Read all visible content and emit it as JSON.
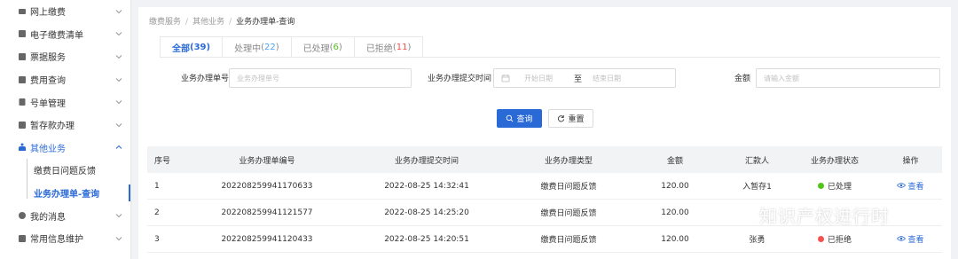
{
  "sidebar": {
    "items": [
      {
        "label": "网上缴费"
      },
      {
        "label": "电子缴费清单"
      },
      {
        "label": "票据服务"
      },
      {
        "label": "费用查询"
      },
      {
        "label": "号单管理"
      },
      {
        "label": "暂存款办理"
      },
      {
        "label": "其他业务"
      },
      {
        "label": "我的消息"
      },
      {
        "label": "常用信息维护"
      }
    ],
    "subitems": [
      {
        "label": "缴费日问题反馈"
      },
      {
        "label": "业务办理单-查询"
      }
    ]
  },
  "breadcrumb": {
    "item1": "缴费服务",
    "item2": "其他业务",
    "current": "业务办理单-查询",
    "sep": "/"
  },
  "tabs": [
    {
      "label": "全部",
      "count": "39",
      "open": "(",
      "close": ")"
    },
    {
      "label": "处理中",
      "count": "22",
      "open": "(",
      "close": ")"
    },
    {
      "label": "已处理",
      "count": "6",
      "open": "(",
      "close": ")"
    },
    {
      "label": "已拒绝",
      "count": "11",
      "open": "(",
      "close": ")"
    }
  ],
  "filters": {
    "order_label": "业务办理单号",
    "order_placeholder": "业务办理单号",
    "time_label": "业务办理提交时间",
    "start_placeholder": "开始日期",
    "to": "至",
    "end_placeholder": "结束日期",
    "amount_label": "金额",
    "amount_placeholder": "请输入金额"
  },
  "buttons": {
    "search": "查询",
    "reset": "重置"
  },
  "table": {
    "headers": [
      "序号",
      "业务办理单编号",
      "业务办理提交时间",
      "业务办理类型",
      "金额",
      "汇款人",
      "业务办理状态",
      "操作"
    ],
    "rows": [
      {
        "idx": "1",
        "no": "202208259941170633",
        "time": "2022-08-25 14:32:41",
        "type": "缴费日问题反馈",
        "amount": "120.00",
        "payer": "入暂存1",
        "status": "已处理",
        "action": "查看"
      },
      {
        "idx": "2",
        "no": "202208259941121577",
        "time": "2022-08-25 14:25:20",
        "type": "缴费日问题反馈",
        "amount": "120.00",
        "payer": "",
        "status": "",
        "action": ""
      },
      {
        "idx": "3",
        "no": "202208259941120433",
        "time": "2022-08-25 14:20:51",
        "type": "缴费日问题反馈",
        "amount": "120.00",
        "payer": "张勇",
        "status": "已拒绝",
        "action": "查看"
      }
    ]
  },
  "colors": {
    "accent": "#2a6ad7",
    "processed": "#52c41a",
    "rejected": "#f5514d"
  },
  "watermark": {
    "text": "知识产权进行时"
  }
}
